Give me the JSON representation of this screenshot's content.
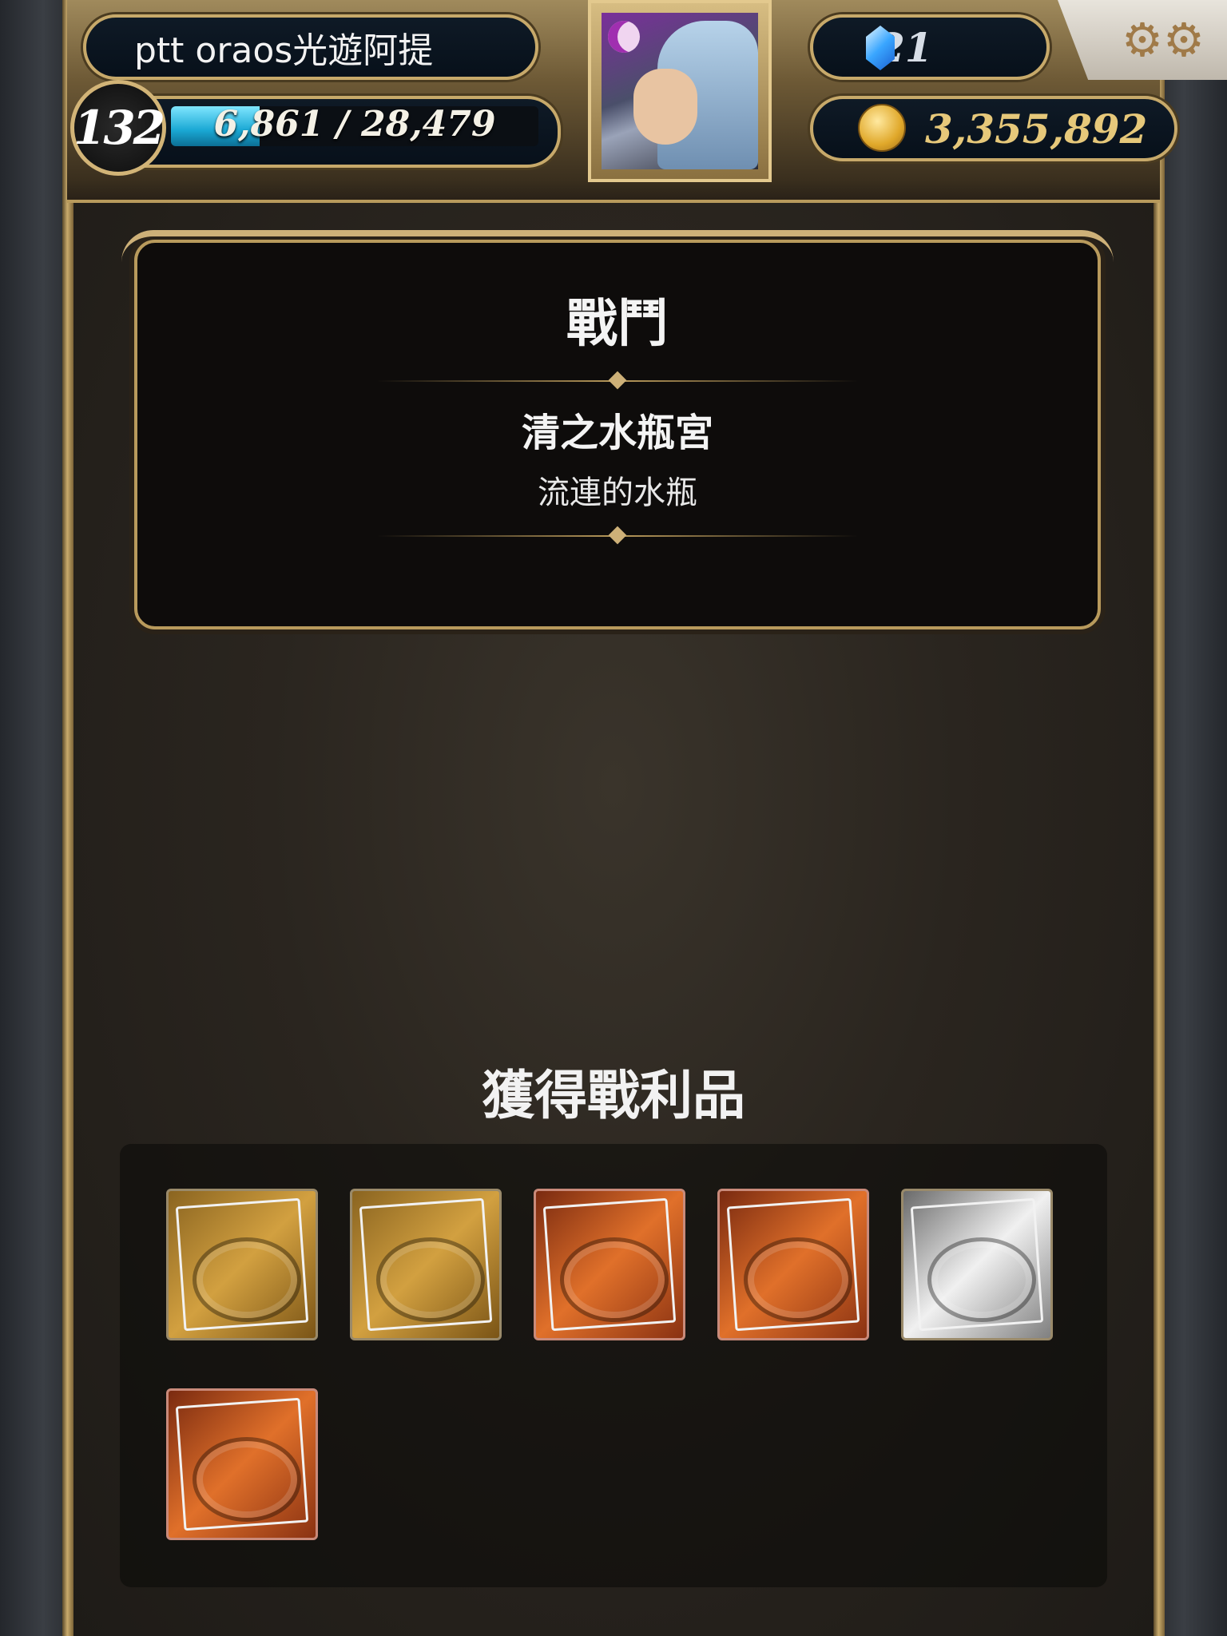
{
  "header": {
    "player_name": "ptt oraos光遊阿提",
    "level": "132",
    "xp_text": "6,861 / 28,479",
    "xp_current": 6861,
    "xp_max": 28479,
    "gems": "21",
    "gold": "3,355,892",
    "gem_icon": "crystal-icon",
    "gold_icon": "coin-icon",
    "settings_icon": "gear-icon"
  },
  "battle": {
    "title": "戰鬥",
    "stage_name": "清之水瓶宮",
    "stage_sub": "流連的水瓶"
  },
  "loot": {
    "title": "獲得戰利品",
    "items": [
      {
        "kind": "gold-card"
      },
      {
        "kind": "gold-card"
      },
      {
        "kind": "red-card"
      },
      {
        "kind": "red-card"
      },
      {
        "kind": "silver-card"
      },
      {
        "kind": "red-card"
      }
    ]
  },
  "colors": {
    "frame_gold": "#c7a96a",
    "xp_bar": "#1aa8d4",
    "panel_bg": "#0e0c0b"
  }
}
